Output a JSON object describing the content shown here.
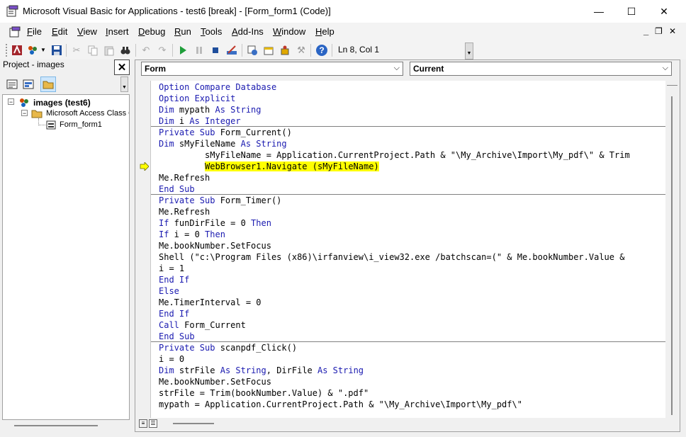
{
  "window": {
    "title": "Microsoft Visual Basic for Applications - test6 [break] - [Form_form1 (Code)]",
    "minimize_glyph": "—",
    "maximize_glyph": "☐",
    "close_glyph": "✕"
  },
  "menu": {
    "items": [
      {
        "label": "File",
        "accel": "F",
        "rest": "ile"
      },
      {
        "label": "Edit",
        "accel": "E",
        "rest": "dit"
      },
      {
        "label": "View",
        "accel": "V",
        "rest": "iew"
      },
      {
        "label": "Insert",
        "accel": "I",
        "rest": "nsert"
      },
      {
        "label": "Debug",
        "accel": "D",
        "rest": "ebug"
      },
      {
        "label": "Run",
        "accel": "R",
        "rest": "un"
      },
      {
        "label": "Tools",
        "accel": "T",
        "rest": "ools"
      },
      {
        "label": "Add-Ins",
        "accel": "A",
        "rest": "dd-Ins"
      },
      {
        "label": "Window",
        "accel": "W",
        "rest": "indow"
      },
      {
        "label": "Help",
        "accel": "H",
        "rest": "elp"
      }
    ],
    "mdi_min": "_",
    "mdi_restore": "❐",
    "mdi_close": "✕"
  },
  "toolbar": {
    "cursor_position": "Ln 8, Col 1"
  },
  "project": {
    "title": "Project - images",
    "close_glyph": "✕",
    "tree": {
      "root": "images (test6)",
      "folder": "Microsoft Access Class O",
      "item": "Form_form1"
    }
  },
  "code": {
    "object_combo": "Form",
    "procedure_combo": "Current",
    "lines": [
      [
        {
          "t": "Option Compare Database",
          "k": 1
        }
      ],
      [
        {
          "t": "Option Explicit",
          "k": 1
        }
      ],
      [
        {
          "t": "Dim",
          "k": 1
        },
        {
          "t": " mypath "
        },
        {
          "t": "As String",
          "k": 1
        }
      ],
      [
        {
          "t": "Dim",
          "k": 1
        },
        {
          "t": " i "
        },
        {
          "t": "As Integer",
          "k": 1
        }
      ],
      [
        {
          "t": "Private Sub",
          "k": 1
        },
        {
          "t": " Form_Current()"
        }
      ],
      [
        {
          "t": "Dim",
          "k": 1
        },
        {
          "t": " sMyFileName "
        },
        {
          "t": "As String",
          "k": 1
        }
      ],
      [
        {
          "t": "         sMyFileName = Application.CurrentProject.Path & \"\\My_Archive\\Import\\My_pdf\\\" & Trim"
        }
      ],
      [
        {
          "t": "         "
        },
        {
          "t": "WebBrowser1.Navigate (sMyFileName)",
          "h": 1
        }
      ],
      [
        {
          "t": "Me.Refresh"
        }
      ],
      [
        {
          "t": "End Sub",
          "k": 1
        }
      ],
      [
        {
          "t": "Private Sub",
          "k": 1
        },
        {
          "t": " Form_Timer()"
        }
      ],
      [
        {
          "t": "Me.Refresh"
        }
      ],
      [
        {
          "t": "If",
          "k": 1
        },
        {
          "t": " funDirFile = 0 "
        },
        {
          "t": "Then",
          "k": 1
        }
      ],
      [
        {
          "t": "If",
          "k": 1
        },
        {
          "t": " i = 0 "
        },
        {
          "t": "Then",
          "k": 1
        }
      ],
      [
        {
          "t": "Me.bookNumber.SetFocus"
        }
      ],
      [
        {
          "t": "Shell (\"c:\\Program Files (x86)\\irfanview\\i_view32.exe /batchscan=(\" & Me.bookNumber.Value &"
        }
      ],
      [
        {
          "t": "i = 1"
        }
      ],
      [
        {
          "t": "End If",
          "k": 1
        }
      ],
      [
        {
          "t": "Else",
          "k": 1
        }
      ],
      [
        {
          "t": "Me.TimerInterval = 0"
        }
      ],
      [
        {
          "t": "End If",
          "k": 1
        }
      ],
      [
        {
          "t": "Call",
          "k": 1
        },
        {
          "t": " Form_Current"
        }
      ],
      [
        {
          "t": "End Sub",
          "k": 1
        }
      ],
      [
        {
          "t": "Private Sub",
          "k": 1
        },
        {
          "t": " scanpdf_Click()"
        }
      ],
      [
        {
          "t": "i = 0"
        }
      ],
      [
        {
          "t": "Dim",
          "k": 1
        },
        {
          "t": " strFile "
        },
        {
          "t": "As String",
          "k": 1
        },
        {
          "t": ", DirFile "
        },
        {
          "t": "As String",
          "k": 1
        }
      ],
      [
        {
          "t": "Me.bookNumber.SetFocus"
        }
      ],
      [
        {
          "t": "strFile = Trim(bookNumber.Value) & \".pdf\""
        }
      ],
      [
        {
          "t": "mypath = Application.CurrentProject.Path & \"\\My_Archive\\Import\\My_pdf\\\""
        }
      ]
    ],
    "procedure_separators_after": [
      3,
      9,
      22
    ],
    "execution_line_index": 7
  },
  "colors": {
    "keyword": "#1a1ab0",
    "highlight": "#ffff00",
    "exec_arrow": "#ffff00"
  }
}
